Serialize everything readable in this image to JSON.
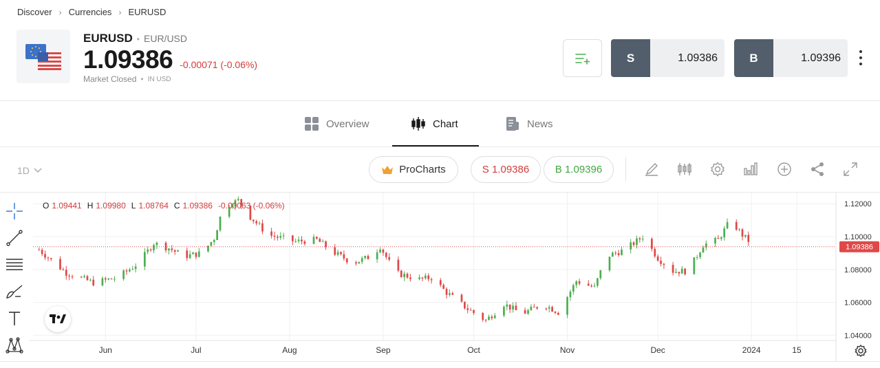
{
  "breadcrumb": {
    "items": [
      "Discover",
      "Currencies",
      "EURUSD"
    ]
  },
  "instrument": {
    "symbol": "EURUSD",
    "pair": "EUR/USD",
    "price": "1.09386",
    "change": "-0.00071 (-0.06%)",
    "status": "Market Closed",
    "currency_note": "IN USD"
  },
  "trade": {
    "sell_letter": "S",
    "sell_price": "1.09386",
    "buy_letter": "B",
    "buy_price": "1.09396"
  },
  "tabs": [
    {
      "label": "Overview",
      "icon": "grid-icon"
    },
    {
      "label": "Chart",
      "icon": "candlestick-icon",
      "active": true
    },
    {
      "label": "News",
      "icon": "news-icon"
    }
  ],
  "toolbar": {
    "timeframe": "1D",
    "procharts_label": "ProCharts",
    "sell_pill": "S 1.09386",
    "buy_pill": "B 1.09396",
    "icons": [
      "draw-icon",
      "indicators-icon",
      "settings-icon",
      "chart-type-icon",
      "add-icon",
      "share-icon",
      "fullscreen-icon"
    ]
  },
  "left_tools": [
    "crosshair-icon",
    "trendline-icon",
    "fib-lines-icon",
    "brush-icon",
    "text-icon",
    "pattern-icon"
  ],
  "ohlc": {
    "o_label": "O",
    "o": "1.09441",
    "h_label": "H",
    "h": "1.09980",
    "l_label": "L",
    "l": "1.08764",
    "c_label": "C",
    "c": "1.09386",
    "change": "-0.00063 (-0.06%)"
  },
  "colors": {
    "up": "#4caf50",
    "down": "#e04848",
    "accent_green": "#3fa83f",
    "accent_red": "#d23c3c",
    "dark_button": "#525e6b"
  },
  "chart_data": {
    "type": "candlestick",
    "y_ticks": [
      "1.12000",
      "1.10000",
      "1.08000",
      "1.06000",
      "1.04000"
    ],
    "y_values": [
      1.12,
      1.1,
      1.08,
      1.06,
      1.04
    ],
    "ylim": [
      1.0368,
      1.1268
    ],
    "x_ticks": [
      "Jun",
      "Jul",
      "Aug",
      "Sep",
      "Oct",
      "Nov",
      "Dec",
      "2024",
      "15"
    ],
    "x_tick_days": [
      22,
      52,
      83,
      114,
      144,
      175,
      205,
      236,
      251
    ],
    "current_price_label": "1.09386",
    "current_price": 1.09386,
    "close_path": [
      {
        "d": 0,
        "v": 1.092
      },
      {
        "d": 9,
        "v": 1.078
      },
      {
        "d": 18,
        "v": 1.072
      },
      {
        "d": 26,
        "v": 1.075
      },
      {
        "d": 33,
        "v": 1.084
      },
      {
        "d": 38,
        "v": 1.096
      },
      {
        "d": 43,
        "v": 1.093
      },
      {
        "d": 48,
        "v": 1.088
      },
      {
        "d": 54,
        "v": 1.09
      },
      {
        "d": 58,
        "v": 1.099
      },
      {
        "d": 61,
        "v": 1.118
      },
      {
        "d": 66,
        "v": 1.122
      },
      {
        "d": 70,
        "v": 1.112
      },
      {
        "d": 76,
        "v": 1.101
      },
      {
        "d": 85,
        "v": 1.097
      },
      {
        "d": 92,
        "v": 1.098
      },
      {
        "d": 98,
        "v": 1.09
      },
      {
        "d": 104,
        "v": 1.084
      },
      {
        "d": 110,
        "v": 1.088
      },
      {
        "d": 113,
        "v": 1.094
      },
      {
        "d": 118,
        "v": 1.078
      },
      {
        "d": 126,
        "v": 1.074
      },
      {
        "d": 130,
        "v": 1.075
      },
      {
        "d": 135,
        "v": 1.066
      },
      {
        "d": 142,
        "v": 1.056
      },
      {
        "d": 148,
        "v": 1.049
      },
      {
        "d": 154,
        "v": 1.059
      },
      {
        "d": 160,
        "v": 1.053
      },
      {
        "d": 167,
        "v": 1.059
      },
      {
        "d": 172,
        "v": 1.054
      },
      {
        "d": 178,
        "v": 1.073
      },
      {
        "d": 184,
        "v": 1.069
      },
      {
        "d": 188,
        "v": 1.088
      },
      {
        "d": 194,
        "v": 1.092
      },
      {
        "d": 200,
        "v": 1.1
      },
      {
        "d": 205,
        "v": 1.087
      },
      {
        "d": 210,
        "v": 1.079
      },
      {
        "d": 215,
        "v": 1.079
      },
      {
        "d": 220,
        "v": 1.095
      },
      {
        "d": 225,
        "v": 1.098
      },
      {
        "d": 229,
        "v": 1.11
      },
      {
        "d": 233,
        "v": 1.101
      },
      {
        "d": 237,
        "v": 1.094
      }
    ]
  }
}
